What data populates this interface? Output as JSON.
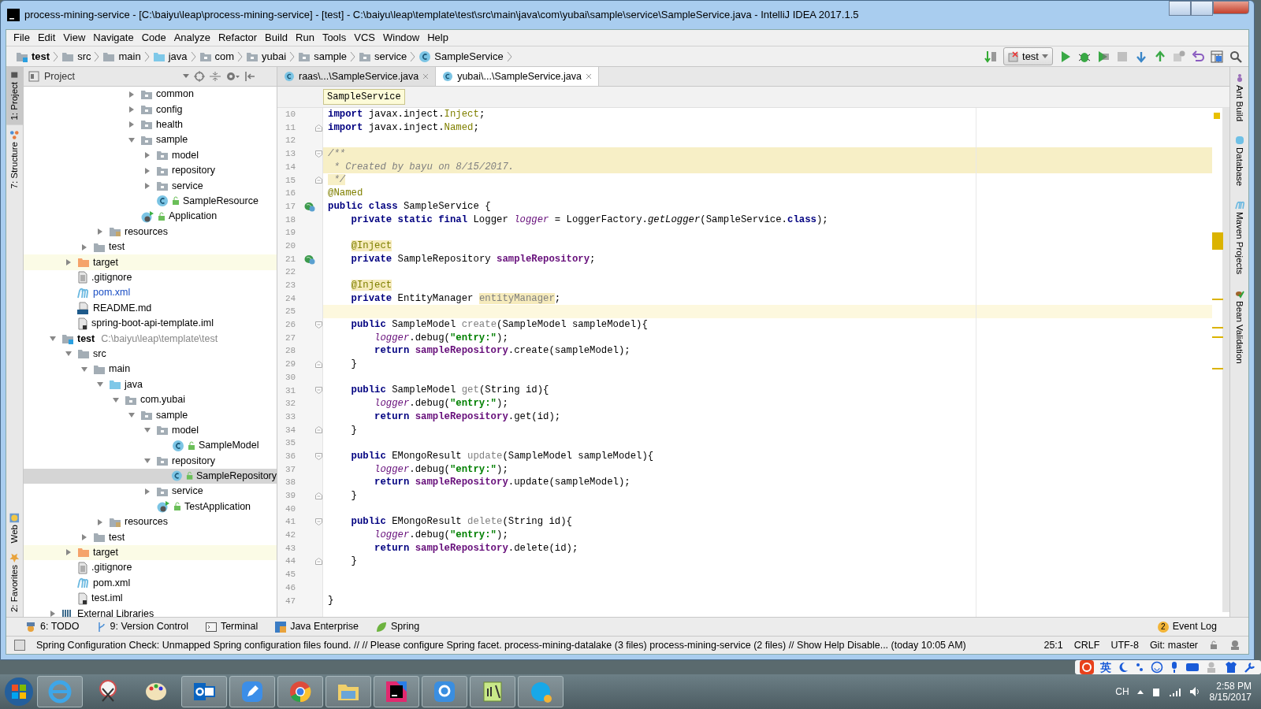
{
  "window": {
    "title": "process-mining-service - [C:\\baiyu\\leap\\process-mining-service] - [test] - C:\\baiyu\\leap\\template\\test\\src\\main\\java\\com\\yubai\\sample\\service\\SampleService.java - IntelliJ IDEA 2017.1.5"
  },
  "menu": [
    "File",
    "Edit",
    "View",
    "Navigate",
    "Code",
    "Analyze",
    "Refactor",
    "Build",
    "Run",
    "Tools",
    "VCS",
    "Window",
    "Help"
  ],
  "navigation_bar": {
    "crumbs": [
      {
        "label": "test",
        "kind": "module"
      },
      {
        "label": "src",
        "kind": "folder"
      },
      {
        "label": "main",
        "kind": "folder"
      },
      {
        "label": "java",
        "kind": "source"
      },
      {
        "label": "com",
        "kind": "package"
      },
      {
        "label": "yubai",
        "kind": "package"
      },
      {
        "label": "sample",
        "kind": "package"
      },
      {
        "label": "service",
        "kind": "package"
      },
      {
        "label": "SampleService",
        "kind": "class"
      }
    ],
    "run_configuration": "test"
  },
  "left_tool_tabs": [
    {
      "label": "1: Project",
      "selected": true,
      "kind": "project"
    },
    {
      "label": "7: Structure",
      "selected": false,
      "kind": "structure"
    },
    {
      "label": "Web",
      "selected": false,
      "kind": "web"
    },
    {
      "label": "2: Favorites",
      "selected": false,
      "kind": "favorites"
    }
  ],
  "project_panel": {
    "title": "Project",
    "tree": [
      {
        "children": [
          {
            "children": [
              {
                "children": [
                  {
                    "children": [
                      {
                        "children": [
                          {
                            "label": "common",
                            "kind": "package",
                            "expanded": false,
                            "selected": false
                          },
                          {
                            "label": "config",
                            "kind": "package",
                            "expanded": false,
                            "selected": false
                          },
                          {
                            "label": "health",
                            "kind": "package",
                            "expanded": false,
                            "selected": false
                          },
                          {
                            "label": "sample",
                            "kind": "package",
                            "expanded": true,
                            "selected": false,
                            "children": [
                              {
                                "label": "model",
                                "kind": "package",
                                "expanded": false,
                                "selected": false
                              },
                              {
                                "label": "repository",
                                "kind": "package",
                                "expanded": false,
                                "selected": false
                              },
                              {
                                "label": "service",
                                "kind": "package",
                                "expanded": false,
                                "selected": false
                              },
                              {
                                "label": "SampleResource",
                                "kind": "class",
                                "selected": false
                              }
                            ]
                          },
                          {
                            "label": "Application",
                            "kind": "app",
                            "selected": false
                          }
                        ]
                      }
                    ]
                  },
                  {
                    "label": "resources",
                    "kind": "resources",
                    "expanded": false,
                    "selected": false
                  }
                ]
              },
              {
                "label": "test",
                "kind": "folder",
                "expanded": false,
                "selected": false
              }
            ]
          },
          {
            "label": "target",
            "kind": "excluded",
            "expanded": false,
            "selected": false
          },
          {
            "label": ".gitignore",
            "kind": "file",
            "selected": false
          },
          {
            "label": "pom.xml",
            "kind": "maven",
            "selected": false,
            "modified": true
          },
          {
            "label": "README.md",
            "kind": "markdown",
            "selected": false
          },
          {
            "label": "spring-boot-api-template.iml",
            "kind": "iml",
            "selected": false
          }
        ]
      },
      {
        "label": "test",
        "kind": "module",
        "path": "C:\\baiyu\\leap\\template\\test",
        "expanded": true,
        "selected": false,
        "children": [
          {
            "label": "src",
            "kind": "folder",
            "expanded": true,
            "selected": false,
            "children": [
              {
                "label": "main",
                "kind": "folder",
                "expanded": true,
                "selected": false,
                "children": [
                  {
                    "label": "java",
                    "kind": "source",
                    "expanded": true,
                    "selected": false,
                    "children": [
                      {
                        "label": "com.yubai",
                        "kind": "package",
                        "expanded": true,
                        "selected": false,
                        "children": [
                          {
                            "label": "sample",
                            "kind": "package",
                            "expanded": true,
                            "selected": false,
                            "children": [
                              {
                                "label": "model",
                                "kind": "package",
                                "expanded": true,
                                "selected": false,
                                "children": [
                                  {
                                    "label": "SampleModel",
                                    "kind": "class",
                                    "selected": false
                                  }
                                ]
                              },
                              {
                                "label": "repository",
                                "kind": "package",
                                "expanded": true,
                                "selected": false,
                                "children": [
                                  {
                                    "label": "SampleRepository",
                                    "kind": "class",
                                    "selected": true
                                  }
                                ]
                              },
                              {
                                "label": "service",
                                "kind": "package",
                                "expanded": false,
                                "selected": false
                              },
                              {
                                "label": "TestApplication",
                                "kind": "app",
                                "selected": false
                              }
                            ]
                          }
                        ]
                      }
                    ]
                  },
                  {
                    "label": "resources",
                    "kind": "resources",
                    "expanded": false,
                    "selected": false
                  }
                ]
              },
              {
                "label": "test",
                "kind": "folder",
                "expanded": false,
                "selected": false
              }
            ]
          },
          {
            "label": "target",
            "kind": "excluded",
            "expanded": false,
            "selected": false
          },
          {
            "label": ".gitignore",
            "kind": "file",
            "selected": false
          },
          {
            "label": "pom.xml",
            "kind": "maven",
            "selected": false,
            "modified": false
          },
          {
            "label": "test.iml",
            "kind": "iml",
            "selected": false
          }
        ]
      },
      {
        "label": "External Libraries",
        "kind": "library",
        "expanded": false,
        "selected": false
      }
    ]
  },
  "editor": {
    "tabs": [
      {
        "label": "raas\\...\\SampleService.java",
        "selected": false
      },
      {
        "label": "yubai\\...\\SampleService.java",
        "selected": true
      }
    ],
    "breadcrumb": "SampleService",
    "lines": [
      {
        "number": "10",
        "tokens": [
          {
            "text": "import",
            "kind": "keyword"
          },
          {
            "text": " javax.inject.",
            "kind": "plain"
          },
          {
            "text": "Inject",
            "kind": "annotation"
          },
          {
            "text": ";",
            "kind": "plain"
          }
        ]
      },
      {
        "number": "11",
        "fold_end": true,
        "tokens": [
          {
            "text": "import",
            "kind": "keyword"
          },
          {
            "text": " javax.inject.",
            "kind": "plain"
          },
          {
            "text": "Named",
            "kind": "annotation"
          },
          {
            "text": ";",
            "kind": "plain"
          }
        ]
      },
      {
        "number": "12"
      },
      {
        "number": "13",
        "fold_start": true,
        "highlighted": true,
        "tokens": [
          {
            "text": "/**",
            "kind": "comment"
          }
        ]
      },
      {
        "number": "14",
        "highlighted": true,
        "tokens": [
          {
            "text": " * Created by bayu on 8/15/2017.",
            "kind": "comment"
          }
        ]
      },
      {
        "number": "15",
        "fold_end": true,
        "tokens": [
          {
            "text": " */",
            "kind": "comment-flagged"
          }
        ]
      },
      {
        "number": "16",
        "tokens": [
          {
            "text": "@Named",
            "kind": "annotation"
          }
        ]
      },
      {
        "number": "17",
        "bean_marker": true,
        "tokens": [
          {
            "text": "public class",
            "kind": "keyword"
          },
          {
            "text": " SampleService {",
            "kind": "plain"
          }
        ]
      },
      {
        "number": "18",
        "tokens": [
          {
            "text": "    private static final",
            "kind": "keyword"
          },
          {
            "text": " Logger ",
            "kind": "plain"
          },
          {
            "text": "logger",
            "kind": "static-field"
          },
          {
            "text": " = LoggerFactory.",
            "kind": "plain"
          },
          {
            "text": "getLogger",
            "kind": "static-method"
          },
          {
            "text": "(SampleService.",
            "kind": "plain"
          },
          {
            "text": "class",
            "kind": "keyword"
          },
          {
            "text": ");",
            "kind": "plain"
          }
        ]
      },
      {
        "number": "19"
      },
      {
        "number": "20",
        "indented": true,
        "tokens": [
          {
            "text": "@Inject",
            "kind": "annotation-flagged"
          }
        ]
      },
      {
        "number": "21",
        "bean_marker": true,
        "tokens": [
          {
            "text": "    private",
            "kind": "keyword"
          },
          {
            "text": " SampleRepository ",
            "kind": "plain"
          },
          {
            "text": "sampleRepository",
            "kind": "field"
          },
          {
            "text": ";",
            "kind": "plain"
          }
        ]
      },
      {
        "number": "22"
      },
      {
        "number": "23",
        "indented": true,
        "tokens": [
          {
            "text": "@Inject",
            "kind": "annotation-flagged"
          }
        ]
      },
      {
        "number": "24",
        "tokens": [
          {
            "text": "    private",
            "kind": "keyword"
          },
          {
            "text": " EntityManager ",
            "kind": "plain"
          },
          {
            "text": "entityManager",
            "kind": "unused-flagged"
          },
          {
            "text": ";",
            "kind": "plain"
          }
        ]
      },
      {
        "number": "25",
        "current": true
      },
      {
        "number": "26",
        "fold_start": true,
        "tokens": [
          {
            "text": "    public",
            "kind": "keyword"
          },
          {
            "text": " SampleModel ",
            "kind": "plain"
          },
          {
            "text": "create",
            "kind": "unused"
          },
          {
            "text": "(SampleModel sampleModel){",
            "kind": "plain"
          }
        ]
      },
      {
        "number": "27",
        "tokens": [
          {
            "text": "        logger",
            "kind": "static-field"
          },
          {
            "text": ".debug(",
            "kind": "plain"
          },
          {
            "text": "\"entry:\"",
            "kind": "string"
          },
          {
            "text": ");",
            "kind": "plain"
          }
        ]
      },
      {
        "number": "28",
        "tokens": [
          {
            "text": "        return",
            "kind": "keyword"
          },
          {
            "text": " sampleRepository",
            "kind": "field"
          },
          {
            "text": ".create(sampleModel);",
            "kind": "plain"
          }
        ]
      },
      {
        "number": "29",
        "fold_end": true,
        "tokens": [
          {
            "text": "    }",
            "kind": "plain"
          }
        ]
      },
      {
        "number": "30"
      },
      {
        "number": "31",
        "fold_start": true,
        "tokens": [
          {
            "text": "    public",
            "kind": "keyword"
          },
          {
            "text": " SampleModel ",
            "kind": "plain"
          },
          {
            "text": "get",
            "kind": "unused"
          },
          {
            "text": "(String id){",
            "kind": "plain"
          }
        ]
      },
      {
        "number": "32",
        "tokens": [
          {
            "text": "        logger",
            "kind": "static-field"
          },
          {
            "text": ".debug(",
            "kind": "plain"
          },
          {
            "text": "\"entry:\"",
            "kind": "string"
          },
          {
            "text": ");",
            "kind": "plain"
          }
        ]
      },
      {
        "number": "33",
        "tokens": [
          {
            "text": "        return",
            "kind": "keyword"
          },
          {
            "text": " sampleRepository",
            "kind": "field"
          },
          {
            "text": ".get(id);",
            "kind": "plain"
          }
        ]
      },
      {
        "number": "34",
        "fold_end": true,
        "tokens": [
          {
            "text": "    }",
            "kind": "plain"
          }
        ]
      },
      {
        "number": "35"
      },
      {
        "number": "36",
        "fold_start": true,
        "tokens": [
          {
            "text": "    public",
            "kind": "keyword"
          },
          {
            "text": " EMongoResult ",
            "kind": "plain"
          },
          {
            "text": "update",
            "kind": "unused"
          },
          {
            "text": "(SampleModel sampleModel){",
            "kind": "plain"
          }
        ]
      },
      {
        "number": "37",
        "tokens": [
          {
            "text": "        logger",
            "kind": "static-field"
          },
          {
            "text": ".debug(",
            "kind": "plain"
          },
          {
            "text": "\"entry:\"",
            "kind": "string"
          },
          {
            "text": ");",
            "kind": "plain"
          }
        ]
      },
      {
        "number": "38",
        "tokens": [
          {
            "text": "        return",
            "kind": "keyword"
          },
          {
            "text": " sampleRepository",
            "kind": "field"
          },
          {
            "text": ".update(sampleModel);",
            "kind": "plain"
          }
        ]
      },
      {
        "number": "39",
        "fold_end": true,
        "tokens": [
          {
            "text": "    }",
            "kind": "plain"
          }
        ]
      },
      {
        "number": "40"
      },
      {
        "number": "41",
        "fold_start": true,
        "tokens": [
          {
            "text": "    public",
            "kind": "keyword"
          },
          {
            "text": " EMongoResult ",
            "kind": "plain"
          },
          {
            "text": "delete",
            "kind": "unused"
          },
          {
            "text": "(String id){",
            "kind": "plain"
          }
        ]
      },
      {
        "number": "42",
        "tokens": [
          {
            "text": "        logger",
            "kind": "static-field"
          },
          {
            "text": ".debug(",
            "kind": "plain"
          },
          {
            "text": "\"entry:\"",
            "kind": "string"
          },
          {
            "text": ");",
            "kind": "plain"
          }
        ]
      },
      {
        "number": "43",
        "tokens": [
          {
            "text": "        return",
            "kind": "keyword"
          },
          {
            "text": " sampleRepository",
            "kind": "field"
          },
          {
            "text": ".delete(id);",
            "kind": "plain"
          }
        ]
      },
      {
        "number": "44",
        "fold_end": true,
        "tokens": [
          {
            "text": "    }",
            "kind": "plain"
          }
        ]
      },
      {
        "number": "45"
      },
      {
        "number": "46"
      },
      {
        "number": "47",
        "tokens": [
          {
            "text": "}",
            "kind": "plain"
          }
        ]
      }
    ]
  },
  "right_tool_tabs": [
    {
      "label": "Ant Build",
      "kind": "ant"
    },
    {
      "label": "Database",
      "kind": "database"
    },
    {
      "label": "Maven Projects",
      "kind": "maven"
    },
    {
      "label": "Bean Validation",
      "kind": "bean"
    }
  ],
  "bottom_tool_tabs": [
    {
      "label": "6: TODO",
      "kind": "todo"
    },
    {
      "label": "9: Version Control",
      "kind": "vcs"
    },
    {
      "label": "Terminal",
      "kind": "terminal"
    },
    {
      "label": "Java Enterprise",
      "kind": "javaee"
    },
    {
      "label": "Spring",
      "kind": "spring"
    }
  ],
  "event_log": {
    "label": "Event Log",
    "count": "2"
  },
  "status_bar": {
    "message": "Spring Configuration Check: Unmapped Spring configuration files found. // // Please configure Spring facet. process-mining-datalake (3 files) process-mining-service (2 files) // Show Help Disable... (today 10:05 AM)",
    "position": "25:1",
    "line_separator": "CRLF",
    "encoding": "UTF-8",
    "vcs_branch": "Git: master"
  },
  "ime_bar": {
    "mode": "英"
  },
  "taskbar": {
    "apps": [
      {
        "kind": "ie",
        "running": true
      },
      {
        "kind": "snipping",
        "running": false
      },
      {
        "kind": "paint",
        "running": false
      },
      {
        "kind": "outlook",
        "running": true
      },
      {
        "kind": "notes",
        "running": true
      },
      {
        "kind": "chrome",
        "running": true
      },
      {
        "kind": "explorer",
        "running": true
      },
      {
        "kind": "intellij",
        "running": true
      },
      {
        "kind": "translator",
        "running": true
      },
      {
        "kind": "notepad",
        "running": true
      },
      {
        "kind": "skype",
        "running": true
      }
    ],
    "tray": {
      "language": "CH",
      "time": "2:58 PM",
      "date": "8/15/2017"
    }
  }
}
